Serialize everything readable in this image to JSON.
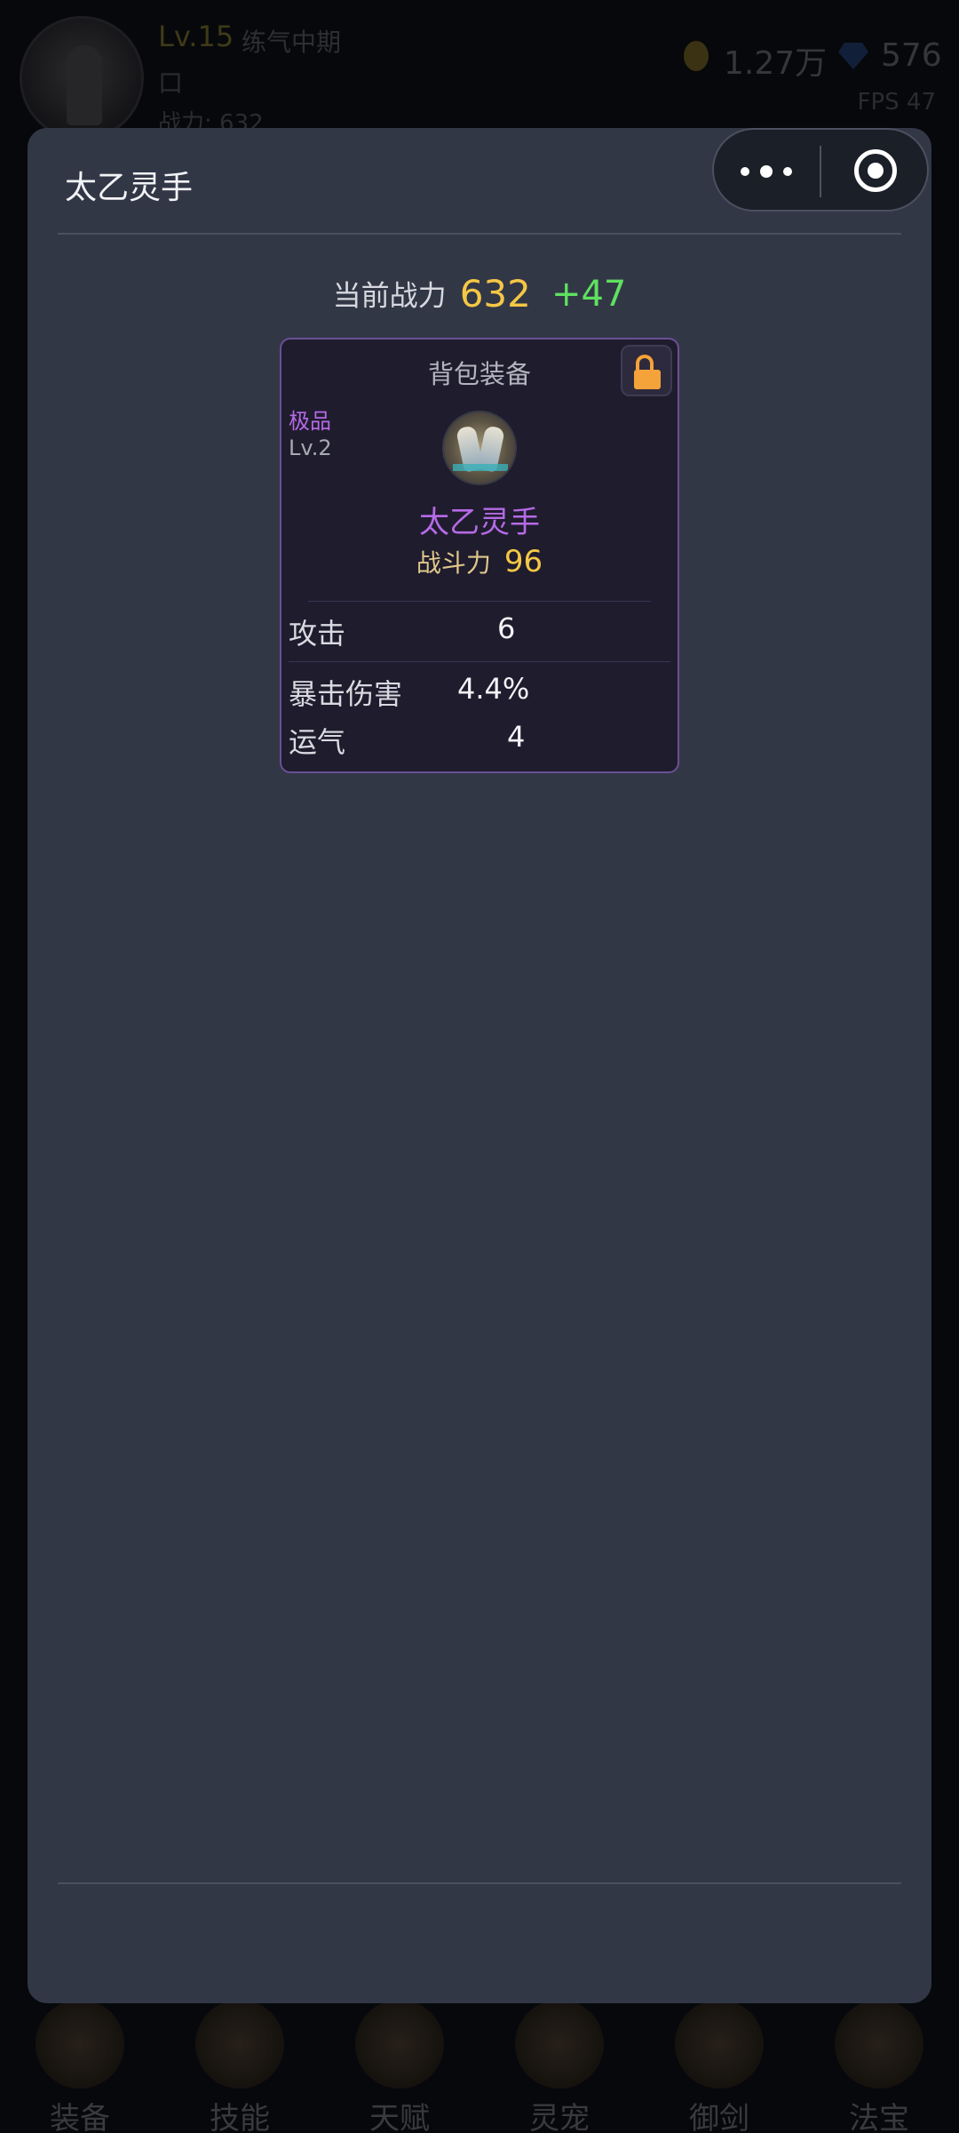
{
  "background": {
    "player": {
      "level": "Lv.15",
      "realm": "练气中期",
      "name": "口",
      "power_text": "战力: 632"
    },
    "currency": {
      "gold": "1.27万",
      "gems": "576"
    },
    "fps": "FPS 47",
    "bottom_tabs": [
      "装备",
      "技能",
      "天赋",
      "灵宠",
      "御剑",
      "法宝"
    ]
  },
  "modal": {
    "title": "太乙灵手",
    "capsule": {
      "more_icon": "more-dots-icon",
      "close_icon": "target-close-icon"
    },
    "current_power": {
      "label": "当前战力",
      "value": "632",
      "delta": "+47"
    },
    "item_card": {
      "header": "背包装备",
      "lock_icon": "unlock-icon",
      "rarity": "极品",
      "level": "Lv.2",
      "icon": "gloves-icon",
      "name": "太乙灵手",
      "power_label": "战斗力",
      "power_value": "96",
      "stats": [
        {
          "label": "攻击",
          "value": "6"
        },
        {
          "label": "暴击伤害",
          "value": "4.4%"
        },
        {
          "label": "运气",
          "value": "4"
        }
      ]
    }
  },
  "colors": {
    "modal_bg": "#323746",
    "rarity_purple": "#b56ae6",
    "power_gold": "#f5c745",
    "delta_green": "#5fe15f",
    "lock_orange": "#f4a23a"
  }
}
